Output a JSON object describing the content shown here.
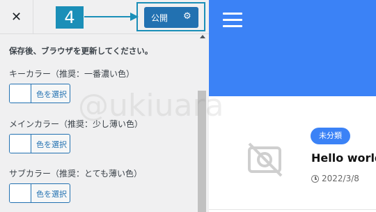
{
  "topbar": {
    "close_glyph": "✕",
    "step_number": "4",
    "publish_label": "公開",
    "publish_gear_glyph": "⚙"
  },
  "panel": {
    "note": "保存後、ブラウザを更新してください。",
    "colors": [
      {
        "label": "キーカラー（推奨：一番濃い色）",
        "button": "色を選択"
      },
      {
        "label": "メインカラー（推奨：少し薄い色）",
        "button": "色を選択"
      },
      {
        "label": "サブカラー（推奨：とても薄い色）",
        "button": "色を選択"
      }
    ]
  },
  "preview": {
    "category": "未分類",
    "post_title": "Hello world",
    "post_date": "2022/3/8",
    "header_color": "#3b82f6"
  },
  "watermark": "@ukiuara",
  "colors": {
    "accent": "#1b8fb8",
    "primary_button": "#2271b1"
  }
}
